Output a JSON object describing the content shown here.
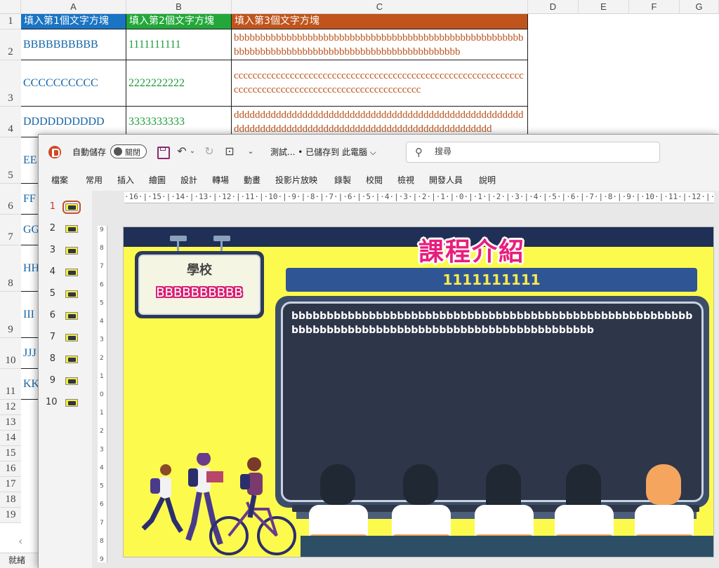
{
  "excel": {
    "columns": [
      "A",
      "B",
      "C",
      "D",
      "E",
      "F",
      "G"
    ],
    "rows": [
      "1",
      "2",
      "3",
      "4",
      "5",
      "6",
      "7",
      "8",
      "9",
      "10",
      "11",
      "12",
      "13",
      "14",
      "15",
      "16",
      "17",
      "18",
      "19"
    ],
    "headers": [
      "填入第1個文字方塊",
      "填入第2個文字方塊",
      "填入第3個文字方塊"
    ],
    "header_colors": [
      "#1a74c4",
      "#22a83a",
      "#c0541c"
    ],
    "cells": [
      {
        "a": "BBBBBBBBBB",
        "b": "1111111111",
        "c": "bbbbbbbbbbbbbbbbbbbbbbbbbbbbbbbbbbbbbbbbbbbbbbbbbbbbbbbbbbbbbbbbbbbbbbbbbbbbbbbbbbbbbbbbbbbbbbbbbb"
      },
      {
        "a": "CCCCCCCCCC",
        "b": "2222222222",
        "c": "cccccccccccccccccccccccccccccccccccccccccccccccccccccccccccccccccccccccccccccccccccccccccccccccccccccc"
      },
      {
        "a": "DDDDDDDDDD",
        "b": "3333333333",
        "c": "dddddddddddddddddddddddddddddddddddddddddddddddddddddddddddddddddddddddddddddddddddddddddddddddddddddddd"
      },
      {
        "a": "EE"
      },
      {
        "a": "FF"
      },
      {
        "a": "GG"
      },
      {
        "a": "HH"
      },
      {
        "a": "III"
      },
      {
        "a": "JJJ"
      },
      {
        "a": "KK"
      }
    ],
    "status": "就緒"
  },
  "ppt": {
    "autosave_label": "自動儲存",
    "autosave_state": "關閉",
    "doc_title": "測試...  • 已儲存到 此電腦 ⌵",
    "search_placeholder": "搜尋",
    "menu": [
      "檔案",
      "常用",
      "插入",
      "繪圖",
      "設計",
      "轉場",
      "動畫",
      "投影片放映",
      "錄製",
      "校閱",
      "檢視",
      "開發人員",
      "說明"
    ],
    "slides": [
      "1",
      "2",
      "3",
      "4",
      "5",
      "6",
      "7",
      "8",
      "9",
      "10"
    ],
    "selected_slide": 1,
    "ruler_h": "·16·|·15·|·14·|·13·|·12·|·11·|·10·|·9·|·8·|·7·|·6·|·5·|·4·|·3·|·2·|·1·|·0·|·1·|·2·|·3·|·4·|·5·|·6·|·7·|·8·|·9·|·10·|·11·|·12·|·13·|·14·|·15·|·16·",
    "ruler_v": [
      "9",
      "8",
      "7",
      "6",
      "5",
      "4",
      "3",
      "2",
      "1",
      "0",
      "1",
      "2",
      "3",
      "4",
      "5",
      "6",
      "7",
      "8",
      "9"
    ]
  },
  "slide": {
    "title": "課程介紹",
    "sign_label": "學校",
    "sign_value": "BBBBBBBBBB",
    "subtitle": "1111111111",
    "board_text": "bbbbbbbbbbbbbbbbbbbbbbbbbbbbbbbbbbbbbbbbbbbbbbbbbbbbbbbbbbbbbbbbbbbbbbbbbbbbbbbbbbbbbbbbbbbbbbbbbbbb",
    "colors": {
      "background": "#fdfa4e",
      "title": "#e91e7b",
      "board": "#2e3749",
      "subtitle_bar": "#2f5595",
      "subtitle_text": "#f8e94c"
    }
  }
}
